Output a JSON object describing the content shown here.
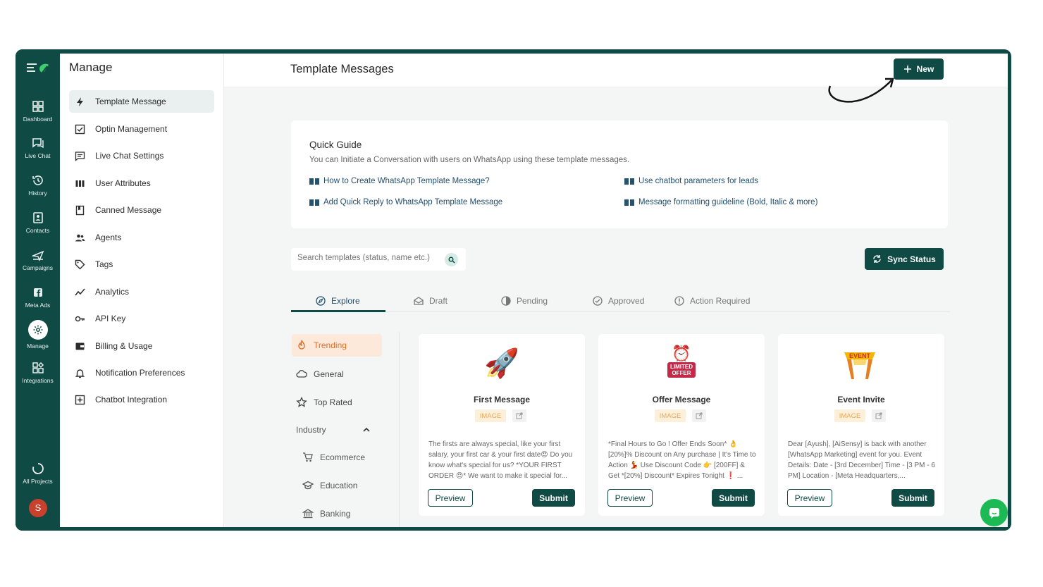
{
  "rail": {
    "items": [
      {
        "label": "Dashboard",
        "icon": "dashboard-icon"
      },
      {
        "label": "Live Chat",
        "icon": "chat-icon"
      },
      {
        "label": "History",
        "icon": "history-icon"
      },
      {
        "label": "Contacts",
        "icon": "contacts-icon"
      },
      {
        "label": "Campaigns",
        "icon": "campaigns-icon"
      },
      {
        "label": "Meta Ads",
        "icon": "facebook-icon"
      },
      {
        "label": "Manage",
        "icon": "gear-icon",
        "active": true
      },
      {
        "label": "Integrations",
        "icon": "integrations-icon"
      },
      {
        "label": "All Projects",
        "icon": "projects-icon"
      }
    ],
    "avatar_letter": "S"
  },
  "manage": {
    "title": "Manage",
    "items": [
      {
        "label": "Template Message",
        "icon": "bolt-icon",
        "active": true
      },
      {
        "label": "Optin Management",
        "icon": "checkbox-icon"
      },
      {
        "label": "Live Chat Settings",
        "icon": "message-square-icon"
      },
      {
        "label": "User Attributes",
        "icon": "columns-icon"
      },
      {
        "label": "Canned Message",
        "icon": "bookmark-icon"
      },
      {
        "label": "Agents",
        "icon": "users-icon"
      },
      {
        "label": "Tags",
        "icon": "tag-icon"
      },
      {
        "label": "Analytics",
        "icon": "trend-icon"
      },
      {
        "label": "API Key",
        "icon": "key-icon"
      },
      {
        "label": "Billing & Usage",
        "icon": "wallet-icon"
      },
      {
        "label": "Notification Preferences",
        "icon": "bell-icon"
      },
      {
        "label": "Chatbot Integration",
        "icon": "plus-square-icon"
      }
    ]
  },
  "header": {
    "title": "Template Messages",
    "new_button": "New"
  },
  "guide": {
    "title": "Quick Guide",
    "subtitle": "You can Initiate a Conversation with users on WhatsApp using these template messages.",
    "links": [
      "How to Create WhatsApp Template Message?",
      "Add Quick Reply to WhatsApp Template Message",
      "Use chatbot parameters for leads",
      "Message formatting guideline (Bold, Italic & more)"
    ]
  },
  "search": {
    "placeholder": "Search templates (status, name etc.)"
  },
  "sync_button": "Sync Status",
  "tabs": [
    {
      "label": "Explore",
      "icon": "compass-icon",
      "active": true
    },
    {
      "label": "Draft",
      "icon": "mail-open-icon"
    },
    {
      "label": "Pending",
      "icon": "pending-icon"
    },
    {
      "label": "Approved",
      "icon": "check-circle-icon"
    },
    {
      "label": "Action Required",
      "icon": "info-circle-icon"
    }
  ],
  "categories": {
    "items": [
      {
        "label": "Trending",
        "icon": "fire-icon",
        "active": true
      },
      {
        "label": "General",
        "icon": "cloud-icon"
      },
      {
        "label": "Top Rated",
        "icon": "star-icon"
      }
    ],
    "industry_label": "Industry",
    "industries": [
      {
        "label": "Ecommerce",
        "icon": "cart-icon"
      },
      {
        "label": "Education",
        "icon": "graduation-icon"
      },
      {
        "label": "Banking",
        "icon": "bank-icon"
      }
    ]
  },
  "cards": [
    {
      "emoji": "🚀",
      "name": "First Message",
      "tag": "IMAGE",
      "body": "The firsts are always special, like your first salary, your first car & your first date😍 Do you know what's special for us? *YOUR FIRST ORDER 😍* We want to make it special for...",
      "preview": "Preview",
      "submit": "Submit"
    },
    {
      "emoji": "⏰",
      "badge": "LIMITED OFFER",
      "name": "Offer Message",
      "tag": "IMAGE",
      "body": "*Final Hours to Go ! Offer Ends Soon* 👌 [20%]% Discount on Any purchase | It's Time to Action 💃 Use Discount Code 👉 [200FF] & Get *[20%] Discount* Expires Tonight ❗ ...",
      "preview": "Preview",
      "submit": "Submit"
    },
    {
      "emoji": "",
      "badge": "EVENT",
      "name": "Event Invite",
      "tag": "IMAGE",
      "body": "Dear [Ayush], [AiSensy] is back with another [WhatsApp Marketing] event for you. Event Details: Date - [3rd December] Time - [3 PM - 6 PM] Location - [Meta Headquarters,...",
      "preview": "Preview",
      "submit": "Submit"
    }
  ],
  "colors": {
    "brand": "#0f4a45",
    "accent_orange": "#e0702a",
    "chat_bubble": "#1db954"
  }
}
